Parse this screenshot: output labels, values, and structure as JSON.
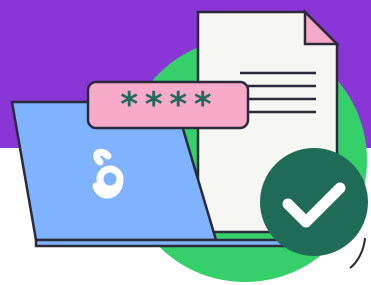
{
  "illustration": {
    "password_mask": "****"
  },
  "colors": {
    "banner": "#8a35d6",
    "circle": "#35d06a",
    "laptop_screen": "#80b3ff",
    "document": "#f6f6f2",
    "document_corner": "#f7a9c8",
    "password_field": "#f7abc9",
    "mask": "#1f6b57",
    "check_badge": "#1f6b57",
    "outline": "#2a2a3a"
  },
  "icons": {
    "app_logo": "okta-like-swirl-icon",
    "status": "checkmark-icon"
  }
}
